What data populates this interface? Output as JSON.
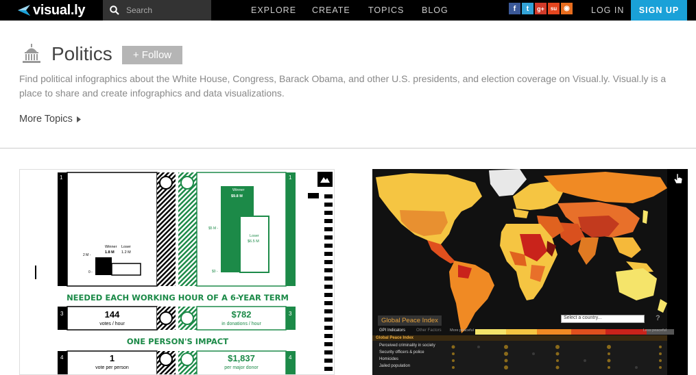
{
  "nav": {
    "logo": "visual.ly",
    "search_placeholder": "Search",
    "links": [
      "EXPLORE",
      "CREATE",
      "TOPICS",
      "BLOG"
    ],
    "login": "LOG IN",
    "signup": "SIGN UP",
    "social": [
      {
        "name": "facebook",
        "glyph": "f",
        "color": "#3b5998"
      },
      {
        "name": "twitter",
        "glyph": "t",
        "color": "#33a3d6"
      },
      {
        "name": "google-plus",
        "glyph": "g+",
        "color": "#d23b2a"
      },
      {
        "name": "stumbleupon",
        "glyph": "su",
        "color": "#e4461f"
      },
      {
        "name": "rss",
        "glyph": "◉",
        "color": "#e86d1e"
      }
    ]
  },
  "header": {
    "title": "Politics",
    "follow": "+ Follow",
    "description": "Find political infographics about the White House, Congress, Barack Obama, and other U.S. presidents, and election coverage on Visual.ly. Visual.ly is a place to share and create infographics and data visualizations.",
    "more_topics": "More Topics"
  },
  "card1": {
    "panel_num": "1",
    "winner_label": "Winner",
    "loser_label": "Loser",
    "left_winner_value": "1.8 M",
    "left_loser_value": "1.2 M",
    "left_tick_top": "2 M -",
    "left_tick_bottom": "0 -",
    "right_winner_label": "Winner",
    "right_winner_value": "$9.8 M",
    "right_loser_label": "Loser",
    "right_loser_value": "$6.5 M",
    "right_tick_top": "$5 M -",
    "right_tick_bottom": "$0 -",
    "title1": "NEEDED EACH WORKING HOUR OF A 6-YEAR TERM",
    "row3_num": "3",
    "votes_value": "144",
    "votes_sub": "votes / hour",
    "donations_value": "$782",
    "donations_sub": "in donations / hour",
    "title2": "ONE PERSON'S IMPACT",
    "row4_num": "4",
    "person_value": "1",
    "person_sub": "vote per person",
    "donor_value": "$1,837",
    "donor_sub": "per major donor"
  },
  "card2": {
    "title": "Global Peace Index",
    "select_placeholder": "Select a country...",
    "help": "?",
    "tab_indicators": "GPI Indicators",
    "tab_other": "Other Factors",
    "more_peaceful": "More peaceful",
    "less_peaceful": "Less peaceful",
    "index_label": "Global Peace Index",
    "rows": [
      "Perceived criminality in society",
      "Security officers & police",
      "Homicides",
      "Jailed population"
    ]
  },
  "colors": {
    "nav_bg": "#000000",
    "signup_bg": "#1aa1d8",
    "follow_bg": "#b5b5b5",
    "accent_green": "#1c8a48"
  }
}
